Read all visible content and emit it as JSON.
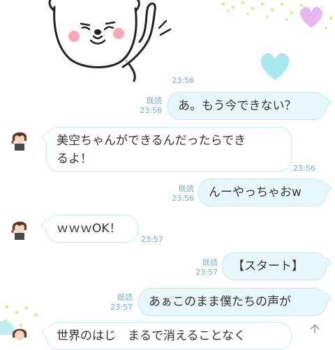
{
  "chat": {
    "messages": [
      {
        "id": "m1",
        "side": "right",
        "text": "あ。もう今できない？",
        "read": "既読",
        "time": "23:56"
      },
      {
        "id": "m2",
        "side": "left",
        "text_lines": [
          "美空ちゃんができるんだったらでき",
          "るよ！"
        ],
        "time": "23:56"
      },
      {
        "id": "m3",
        "side": "right",
        "text": "んーやっちゃおw",
        "read": "既読",
        "time": "23:56"
      },
      {
        "id": "m4",
        "side": "left",
        "text": "ｗｗｗOK！",
        "time": "23:57"
      },
      {
        "id": "m5",
        "side": "right",
        "text": "【スタート】",
        "read": "既読",
        "time": "23:57"
      },
      {
        "id": "m6",
        "side": "right",
        "text": "あぁこのまま僕たちの声が",
        "read": "既読",
        "time": "23:57"
      },
      {
        "id": "m7",
        "side": "left",
        "text": "世界のはじ　まるで消えることなく"
      }
    ],
    "sticker": {
      "time": "23:56",
      "icon": "bear-waving-sticker"
    }
  },
  "colors": {
    "bubble_border": "#c9ebf3",
    "bubble_mine": "#e8f7fb",
    "meta_text": "#6fb3c7",
    "heart_pink": "#e9b8f0",
    "heart_cyan": "#a6e6ea"
  }
}
